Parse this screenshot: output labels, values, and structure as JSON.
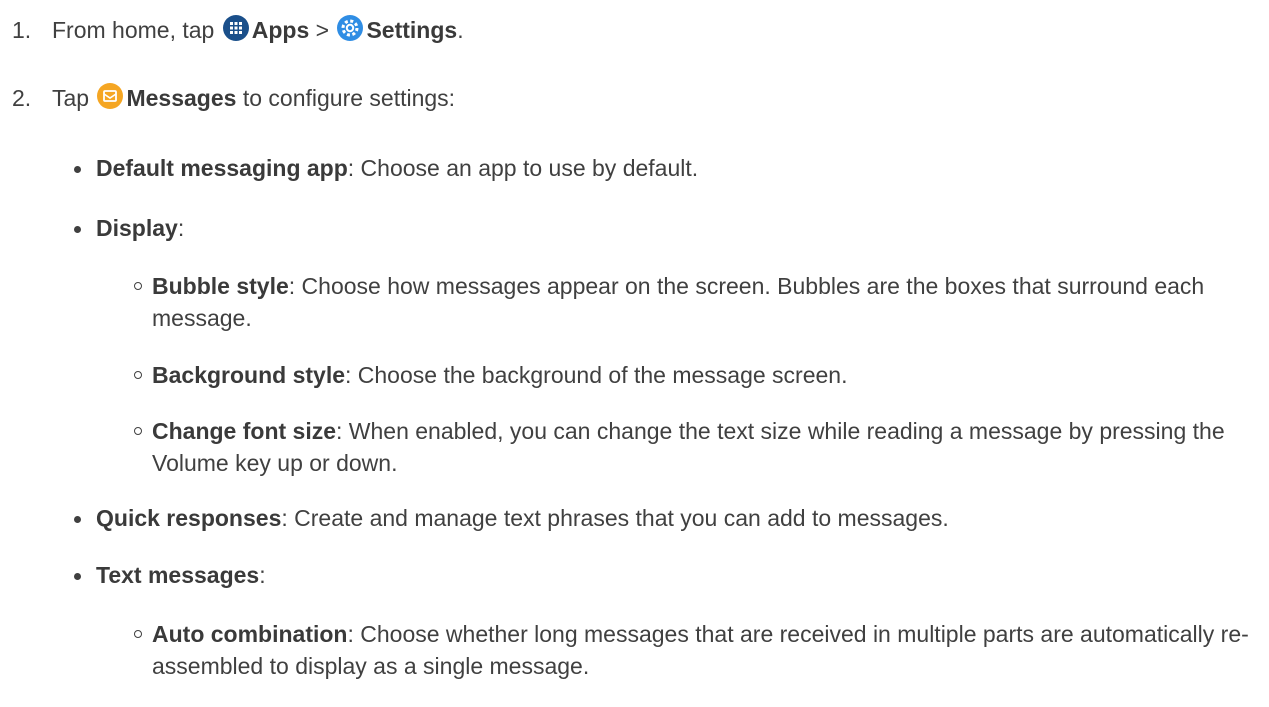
{
  "steps": [
    {
      "num": "1.",
      "pre": "From home, tap",
      "apps": "Apps",
      "sep": ">",
      "settings": "Settings",
      "end": "."
    },
    {
      "num": "2.",
      "pre": "Tap",
      "messages": "Messages",
      "post": "to configure settings:"
    }
  ],
  "items": {
    "default_app": {
      "term": "Default messaging app",
      "desc": ": Choose an app to use by default."
    },
    "display": {
      "term": "Display",
      "desc": ":"
    },
    "bubble": {
      "term": "Bubble style",
      "desc": ": Choose how messages appear on the screen. Bubbles are the boxes that surround each message."
    },
    "background": {
      "term": "Background style",
      "desc": ": Choose the background of the message screen."
    },
    "font": {
      "term": "Change font size",
      "desc": ": When enabled, you can change the text size while reading a message by pressing the Volume key up or down."
    },
    "quick": {
      "term": "Quick responses",
      "desc": ": Create and manage text phrases that you can add to messages."
    },
    "text": {
      "term": "Text messages",
      "desc": ":"
    },
    "auto": {
      "term": "Auto combination",
      "desc": ": Choose whether long messages that are received in multiple parts are automatically re-assembled to display as a single message."
    }
  },
  "icons": {
    "apps": "apps-grid-icon",
    "settings": "settings-gear-icon",
    "messages": "messages-envelope-icon"
  },
  "colors": {
    "apps_icon": "#1a4f8a",
    "settings_icon": "#2f8de4",
    "messages_icon": "#f5a623"
  }
}
